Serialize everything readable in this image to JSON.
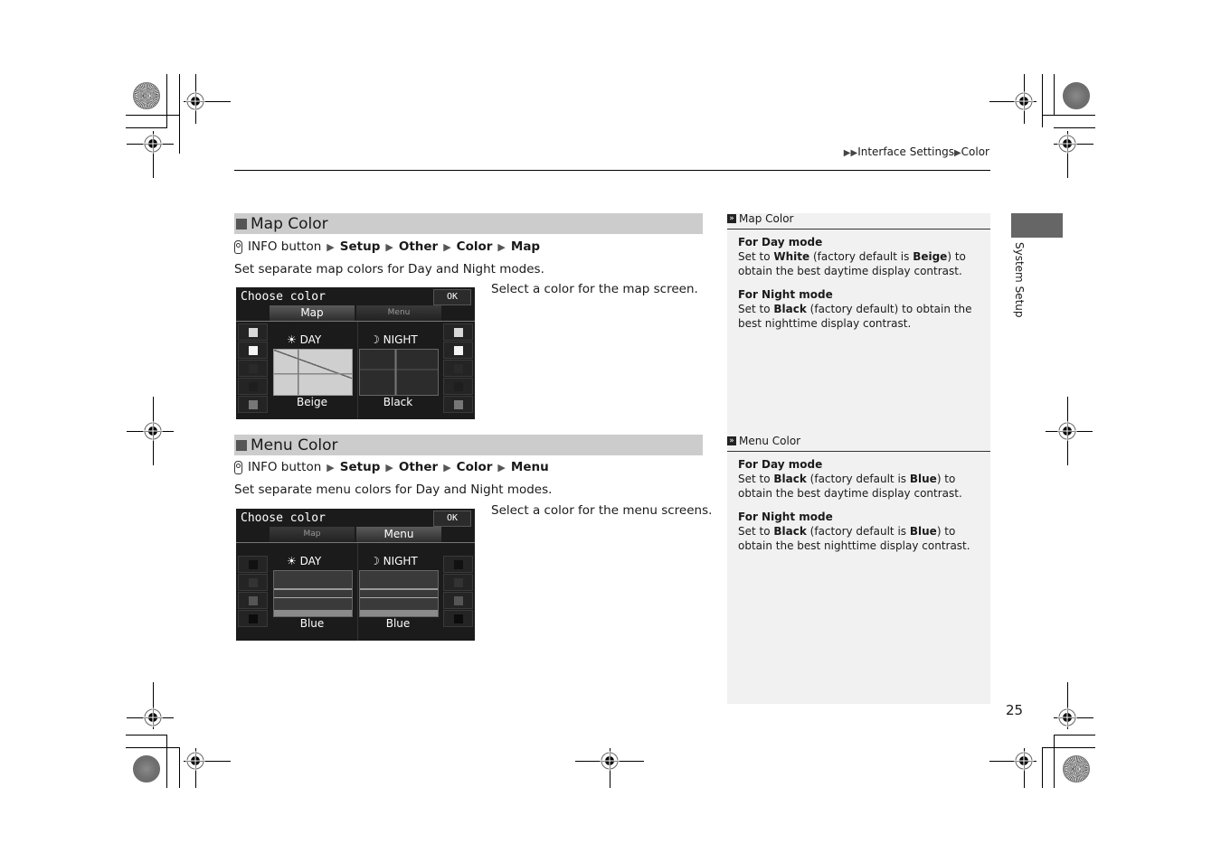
{
  "header": {
    "breadcrumb": [
      "Interface Settings",
      "Color"
    ]
  },
  "sections": [
    {
      "title": "Map Color",
      "path": {
        "start": "INFO button",
        "steps": [
          "Setup",
          "Other",
          "Color",
          "Map"
        ]
      },
      "description": "Set separate map colors for Day and Night modes.",
      "caption": "Select a color for the map screen.",
      "screen": {
        "title": "Choose color",
        "ok_label": "OK",
        "tabs": [
          {
            "label": "Map",
            "active": true
          },
          {
            "label": "Menu",
            "active": false
          }
        ],
        "day_label": "DAY",
        "night_label": "NIGHT",
        "day_color": "Beige",
        "night_color": "Black",
        "left_swatches": [
          "#d8d8d8",
          "#f4f4f4",
          "#2a2a2a",
          "#1e1e1e",
          "#777777"
        ],
        "right_swatches": [
          "#d8d8d8",
          "#f4f4f4",
          "#2a2a2a",
          "#1e1e1e",
          "#777777"
        ]
      }
    },
    {
      "title": "Menu Color",
      "path": {
        "start": "INFO button",
        "steps": [
          "Setup",
          "Other",
          "Color",
          "Menu"
        ]
      },
      "description": "Set separate menu colors for Day and Night modes.",
      "caption": "Select a color for the menu screens.",
      "screen": {
        "title": "Choose color",
        "ok_label": "OK",
        "tabs": [
          {
            "label": "Map",
            "active": false
          },
          {
            "label": "Menu",
            "active": true
          }
        ],
        "day_label": "DAY",
        "night_label": "NIGHT",
        "day_color": "Blue",
        "night_color": "Blue",
        "left_swatches": [
          "#111111",
          "#333333",
          "#555555",
          "#0c0c0c"
        ],
        "right_swatches": [
          "#111111",
          "#333333",
          "#555555",
          "#0c0c0c"
        ]
      }
    }
  ],
  "notes": [
    {
      "heading": "Map Color",
      "items": [
        {
          "title": "For Day mode",
          "pre": "Set to ",
          "b1": "White",
          "mid": " (factory default is ",
          "b2": "Beige",
          "post": ") to obtain the best daytime display contrast."
        },
        {
          "title": "For Night mode",
          "pre": "Set to ",
          "b1": "Black",
          "mid": " (factory default) to obtain the best nighttime display contrast.",
          "b2": "",
          "post": ""
        }
      ]
    },
    {
      "heading": "Menu Color",
      "items": [
        {
          "title": "For Day mode",
          "pre": "Set to ",
          "b1": "Black",
          "mid": " (factory default is ",
          "b2": "Blue",
          "post": ") to obtain the best daytime display contrast."
        },
        {
          "title": "For Night mode",
          "pre": "Set to ",
          "b1": "Black",
          "mid": " (factory default is ",
          "b2": "Blue",
          "post": ") to obtain the best nighttime display contrast."
        }
      ]
    }
  ],
  "side_tab": "System Setup",
  "page_number": "25"
}
